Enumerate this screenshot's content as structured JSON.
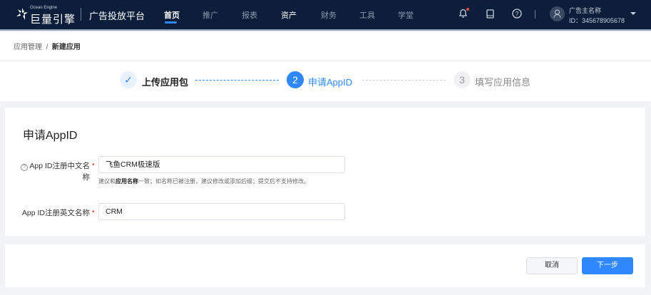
{
  "header": {
    "brand_small": "Ocean Engine",
    "brand": "巨量引擎",
    "platform": "广告投放平台",
    "nav": [
      {
        "label": "首页"
      },
      {
        "label": "推广"
      },
      {
        "label": "报表"
      },
      {
        "label": "资产"
      },
      {
        "label": "财务"
      },
      {
        "label": "工具"
      },
      {
        "label": "学堂"
      }
    ],
    "user": {
      "name": "广告主名称",
      "id": "ID：345678905678"
    }
  },
  "breadcrumb": {
    "parent": "应用管理",
    "separator": "/",
    "current": "新建应用"
  },
  "steps": [
    {
      "num": "✓",
      "label": "上传应用包",
      "state": "done"
    },
    {
      "num": "2",
      "label": "申请AppID",
      "state": "active"
    },
    {
      "num": "3",
      "label": "填写应用信息",
      "state": "pending"
    }
  ],
  "form": {
    "title": "申请AppID",
    "cn_name": {
      "help": "?",
      "label_line1": "App ID注册中文名",
      "label_line2": "称",
      "value": "飞鱼CRM极速版",
      "hint_pre": "建议和",
      "hint_bold": "应用名称",
      "hint_post": "一致；如名称已被注册，建议修改或添加后缀；提交后不支持修改。"
    },
    "en_name": {
      "label": "App ID注册英文名称",
      "value": "CRM"
    },
    "required_mark": "•"
  },
  "footer": {
    "cancel": "取消",
    "next": "下一步"
  },
  "colors": {
    "primary": "#2f88ff",
    "header_bg": "#0c1e3b"
  }
}
